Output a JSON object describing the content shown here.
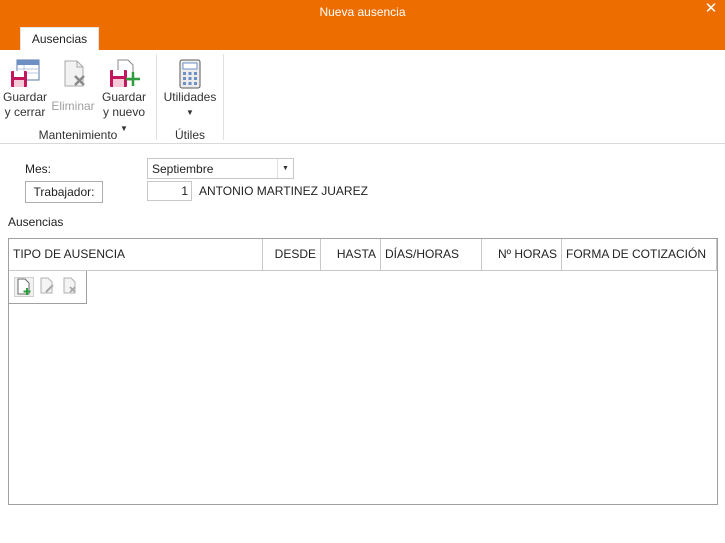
{
  "window": {
    "title": "Nueva ausencia"
  },
  "tabs": [
    {
      "label": "Ausencias"
    }
  ],
  "ribbon": {
    "guardar_cerrar": {
      "line1": "Guardar",
      "line2": "y cerrar"
    },
    "eliminar": {
      "label": "Eliminar"
    },
    "guardar_nuevo": {
      "line1": "Guardar",
      "line2": "y nuevo"
    },
    "utilidades": {
      "label": "Utilidades"
    },
    "groups": {
      "mantenimiento": "Mantenimiento",
      "utiles": "Útiles"
    }
  },
  "form": {
    "mes_label": "Mes:",
    "mes_value": "Septiembre",
    "trabajador_button": "Trabajador:",
    "trabajador_id": "1",
    "trabajador_name": "ANTONIO MARTINEZ JUAREZ"
  },
  "section": {
    "ausencias_label": "Ausencias"
  },
  "table": {
    "columns": [
      "TIPO DE AUSENCIA",
      "DESDE",
      "HASTA",
      "DÍAS/HORAS",
      "Nº HORAS",
      "FORMA DE COTIZACIÓN"
    ],
    "rows": []
  },
  "icons": {
    "close": "close-icon",
    "guardar_cerrar": "save-close-icon",
    "eliminar": "delete-icon",
    "guardar_nuevo": "save-new-icon",
    "utilidades": "calculator-icon",
    "row_add": "add-row-icon",
    "row_edit": "edit-row-icon",
    "row_delete": "delete-row-icon"
  },
  "colors": {
    "accent": "#ed6d00",
    "save": "#c2185b",
    "add": "#2e9e3c"
  }
}
